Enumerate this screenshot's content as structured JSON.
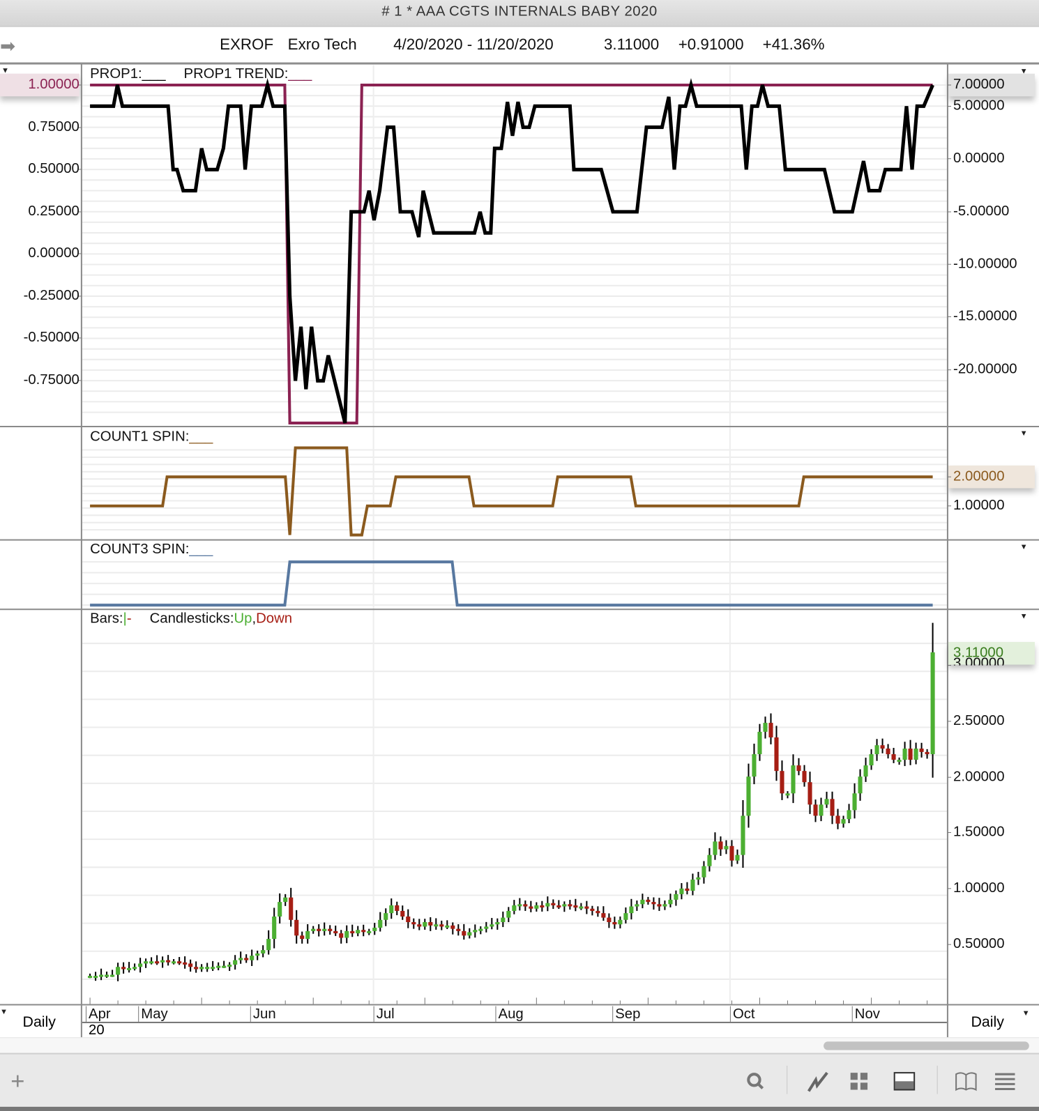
{
  "window": {
    "title": "# 1 * AAA  CGTS INTERNALS BABY 2020"
  },
  "info": {
    "symbol": "EXROF",
    "name": "Exro Tech",
    "date_range": "4/20/2020 - 11/20/2020",
    "last": "3.11000",
    "change": "+0.91000",
    "change_pct": "+41.36%"
  },
  "panels": {
    "prop1": {
      "label": "PROP1:",
      "trend_label": "PROP1 TREND:",
      "blank": "___",
      "left_highlight": "1.00000",
      "right_highlight": "7.00000",
      "left_ticks": [
        "0.75000",
        "0.50000",
        "0.25000",
        "0.00000",
        "-0.25000",
        "-0.50000",
        "-0.75000"
      ],
      "right_ticks": [
        "5.00000",
        "0.00000",
        "-5.00000",
        "-10.00000",
        "-15.00000",
        "-20.00000"
      ]
    },
    "count1": {
      "label": "COUNT1 SPIN:",
      "blank": "___",
      "right_highlight": "2.00000",
      "right_ticks": [
        "1.00000"
      ]
    },
    "count3": {
      "label": "COUNT3 SPIN:",
      "blank": "___"
    },
    "price": {
      "bars_label": "Bars:",
      "bars_up": "|",
      "bars_down": "-",
      "candles_label": "Candlesticks:",
      "up": "Up",
      "comma": ",",
      "down": "Down",
      "right_highlight": "3.11000",
      "right_ticks": [
        "3.00000",
        "2.50000",
        "2.00000",
        "1.50000",
        "1.00000",
        "0.50000"
      ]
    }
  },
  "date_axis": {
    "months": [
      "Apr",
      "May",
      "Jun",
      "Jul",
      "Aug",
      "Sep",
      "Oct",
      "Nov"
    ],
    "year": "20",
    "period_left": "Daily",
    "period_right": "Daily"
  },
  "toolbar": {
    "icons": [
      "plus-icon",
      "search-icon",
      "line-chart-icon",
      "grid-icon",
      "panel-icon",
      "book-icon",
      "menu-icon"
    ]
  },
  "colors": {
    "prop1": "#000000",
    "prop1_trend": "#8b2252",
    "count1": "#8b5a1e",
    "count3": "#5878a0",
    "up": "#4caf32",
    "down": "#a61e14"
  },
  "chart_data": [
    {
      "type": "line",
      "title": "PROP1 / PROP1 TREND",
      "x_unit": "trading day index from 4/20/2020",
      "ylim": [
        -1,
        1
      ],
      "series": [
        {
          "name": "PROP1",
          "points": [
            [
              0,
              0.875
            ],
            [
              4.2,
              0.875
            ],
            [
              4.9,
              1
            ],
            [
              5.8,
              0.875
            ],
            [
              14,
              0.875
            ],
            [
              14.9,
              0.5
            ],
            [
              15.6,
              0.5
            ],
            [
              16.7,
              0.375
            ],
            [
              18.9,
              0.375
            ],
            [
              20,
              0.625
            ],
            [
              20.9,
              0.5
            ],
            [
              22.8,
              0.5
            ],
            [
              23.9,
              0.625
            ],
            [
              24.8,
              0.875
            ],
            [
              27,
              0.875
            ],
            [
              27.8,
              0.5
            ],
            [
              28.9,
              0.875
            ],
            [
              30.8,
              0.875
            ],
            [
              31.8,
              1
            ],
            [
              32.8,
              0.875
            ],
            [
              34.9,
              0.875
            ],
            [
              35.8,
              -0.25
            ],
            [
              36.8,
              -0.75
            ],
            [
              37.8,
              -0.43
            ],
            [
              38.7,
              -0.8
            ],
            [
              39.7,
              -0.43
            ],
            [
              40.8,
              -0.75
            ],
            [
              41.8,
              -0.75
            ],
            [
              42.7,
              -0.6
            ],
            [
              45.7,
              -1
            ],
            [
              46.8,
              0.25
            ],
            [
              49.1,
              0.25
            ],
            [
              50,
              0.375
            ],
            [
              50.9,
              0.2
            ],
            [
              51.9,
              0.375
            ],
            [
              53.3,
              0.75
            ],
            [
              54.4,
              0.75
            ],
            [
              55.6,
              0.25
            ],
            [
              57.7,
              0.25
            ],
            [
              58.9,
              0.1
            ],
            [
              59.7,
              0.375
            ],
            [
              61.6,
              0.125
            ],
            [
              68.9,
              0.125
            ],
            [
              69.9,
              0.25
            ],
            [
              70.8,
              0.125
            ],
            [
              71.8,
              0.125
            ],
            [
              72.5,
              0.625
            ],
            [
              73.7,
              0.625
            ],
            [
              74.8,
              0.9
            ],
            [
              75.7,
              0.7
            ],
            [
              76.7,
              0.9
            ],
            [
              77.6,
              0.75
            ],
            [
              78.7,
              0.75
            ],
            [
              79.7,
              0.875
            ],
            [
              86,
              0.875
            ],
            [
              86.7,
              0.5
            ],
            [
              91.6,
              0.5
            ],
            [
              93.7,
              0.25
            ],
            [
              98,
              0.25
            ],
            [
              99.7,
              0.75
            ],
            [
              102.5,
              0.75
            ],
            [
              103.7,
              0.93
            ],
            [
              104.7,
              0.5
            ],
            [
              105.7,
              0.875
            ],
            [
              106.7,
              0.875
            ],
            [
              107.7,
              1
            ],
            [
              108.7,
              0.875
            ],
            [
              116.7,
              0.875
            ],
            [
              117.6,
              0.5
            ],
            [
              118.6,
              0.875
            ],
            [
              119.6,
              0.875
            ],
            [
              120.5,
              1
            ],
            [
              121.5,
              0.875
            ],
            [
              123.5,
              0.875
            ],
            [
              124.6,
              0.5
            ],
            [
              131.6,
              0.5
            ],
            [
              133.4,
              0.25
            ],
            [
              136.6,
              0.25
            ],
            [
              138.6,
              0.55
            ],
            [
              139.6,
              0.375
            ],
            [
              141.5,
              0.375
            ],
            [
              142.5,
              0.5
            ],
            [
              145.3,
              0.5
            ],
            [
              146.3,
              0.875
            ],
            [
              147.3,
              0.5
            ],
            [
              148.2,
              0.875
            ],
            [
              149.4,
              0.875
            ],
            [
              151,
              1
            ]
          ]
        },
        {
          "name": "PROP1 TREND",
          "points": [
            [
              0,
              1
            ],
            [
              34.9,
              1
            ],
            [
              35.8,
              -1
            ],
            [
              47.8,
              -1
            ],
            [
              48.7,
              1
            ],
            [
              151,
              1
            ]
          ]
        }
      ]
    },
    {
      "type": "line",
      "title": "COUNT1 SPIN",
      "ylim": [
        0,
        3
      ],
      "series": [
        {
          "name": "COUNT1 SPIN",
          "points": [
            [
              0,
              1
            ],
            [
              13,
              1
            ],
            [
              13.8,
              2
            ],
            [
              35,
              2
            ],
            [
              35.8,
              0
            ],
            [
              36.8,
              3
            ],
            [
              46,
              3
            ],
            [
              46.8,
              0
            ],
            [
              48.7,
              0
            ],
            [
              49.7,
              1
            ],
            [
              53.8,
              1
            ],
            [
              54.8,
              2
            ],
            [
              67.9,
              2
            ],
            [
              68.8,
              1
            ],
            [
              82.9,
              1
            ],
            [
              83.8,
              2
            ],
            [
              96.9,
              2
            ],
            [
              97.8,
              1
            ],
            [
              127,
              1
            ],
            [
              127.9,
              2
            ],
            [
              151,
              2
            ]
          ]
        }
      ]
    },
    {
      "type": "line",
      "title": "COUNT3 SPIN",
      "ylim": [
        0,
        1
      ],
      "series": [
        {
          "name": "COUNT3 SPIN",
          "points": [
            [
              0,
              0
            ],
            [
              34.9,
              0
            ],
            [
              35.8,
              1
            ],
            [
              64.9,
              1
            ],
            [
              65.8,
              0
            ],
            [
              151,
              0
            ]
          ]
        }
      ]
    },
    {
      "type": "candlestick",
      "title": "EXROF Daily",
      "ylim": [
        0,
        3.2
      ],
      "start_open": 0.22,
      "close": [
        0.22,
        0.22,
        0.23,
        0.23,
        0.23,
        0.3,
        0.28,
        0.29,
        0.3,
        0.33,
        0.35,
        0.35,
        0.34,
        0.36,
        0.35,
        0.35,
        0.34,
        0.33,
        0.3,
        0.28,
        0.3,
        0.3,
        0.3,
        0.31,
        0.31,
        0.32,
        0.36,
        0.38,
        0.36,
        0.4,
        0.42,
        0.45,
        0.55,
        0.75,
        0.88,
        0.92,
        0.72,
        0.58,
        0.55,
        0.62,
        0.64,
        0.62,
        0.64,
        0.62,
        0.6,
        0.56,
        0.62,
        0.6,
        0.63,
        0.62,
        0.62,
        0.65,
        0.72,
        0.78,
        0.85,
        0.8,
        0.75,
        0.7,
        0.68,
        0.66,
        0.7,
        0.67,
        0.68,
        0.66,
        0.67,
        0.64,
        0.62,
        0.58,
        0.61,
        0.63,
        0.64,
        0.66,
        0.68,
        0.7,
        0.74,
        0.8,
        0.85,
        0.86,
        0.84,
        0.82,
        0.85,
        0.84,
        0.87,
        0.85,
        0.84,
        0.86,
        0.85,
        0.83,
        0.84,
        0.82,
        0.8,
        0.78,
        0.74,
        0.7,
        0.68,
        0.72,
        0.78,
        0.84,
        0.86,
        0.9,
        0.88,
        0.86,
        0.84,
        0.86,
        0.9,
        0.95,
        1.0,
        0.98,
        1.08,
        1.1,
        1.2,
        1.3,
        1.42,
        1.35,
        1.38,
        1.25,
        1.3,
        1.65,
        2.0,
        2.2,
        2.4,
        2.48,
        2.35,
        2.05,
        1.85,
        1.85,
        2.1,
        2.05,
        1.95,
        1.75,
        1.65,
        1.75,
        1.8,
        1.65,
        1.58,
        1.62,
        1.7,
        1.85,
        2.0,
        2.1,
        2.2,
        2.28,
        2.25,
        2.2,
        2.15,
        2.15,
        2.25,
        2.15,
        2.25,
        2.22,
        2.2,
        3.11
      ]
    }
  ]
}
